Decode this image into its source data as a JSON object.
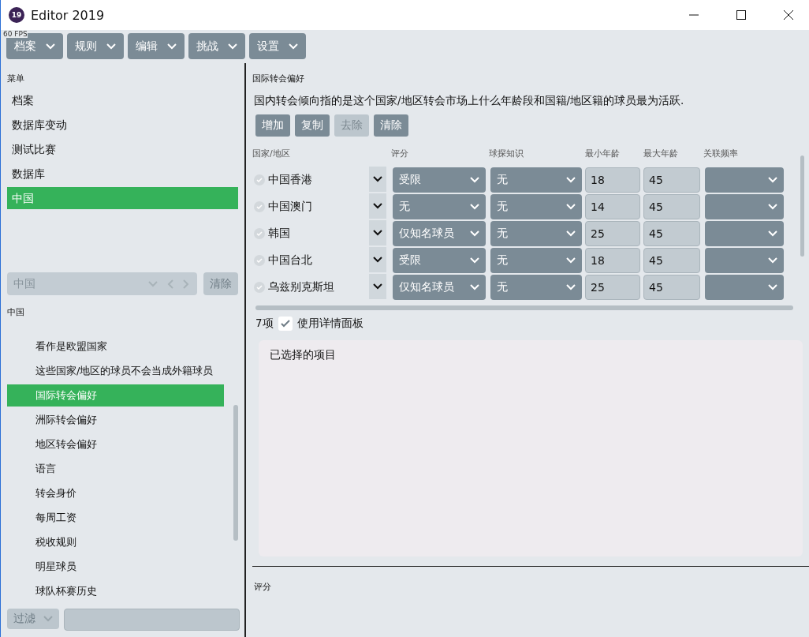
{
  "window": {
    "title": "Editor 2019",
    "icon_text": "19"
  },
  "fps_counter": "60 FPS",
  "toolbar": [
    {
      "label": "档案"
    },
    {
      "label": "规则"
    },
    {
      "label": "编辑"
    },
    {
      "label": "挑战"
    },
    {
      "label": "设置"
    }
  ],
  "menu": {
    "title": "菜单",
    "items": [
      {
        "label": "档案",
        "selected": false
      },
      {
        "label": "数据库变动",
        "selected": false
      },
      {
        "label": "测试比赛",
        "selected": false
      },
      {
        "label": "数据库",
        "selected": false
      },
      {
        "label": "中国",
        "selected": true
      }
    ]
  },
  "country_select": {
    "value": "中国",
    "clear_button": "清除",
    "disabled": true
  },
  "submenu": {
    "title": "中国",
    "items": [
      {
        "label": "看作是欧盟国家",
        "selected": false
      },
      {
        "label": "这些国家/地区的球员不会当成外籍球员",
        "selected": false
      },
      {
        "label": "国际转会偏好",
        "selected": true
      },
      {
        "label": "洲际转会偏好",
        "selected": false
      },
      {
        "label": "地区转会偏好",
        "selected": false
      },
      {
        "label": "语言",
        "selected": false
      },
      {
        "label": "转会身价",
        "selected": false
      },
      {
        "label": "每周工资",
        "selected": false
      },
      {
        "label": "税收规则",
        "selected": false
      },
      {
        "label": "明星球员",
        "selected": false
      },
      {
        "label": "球队杯赛历史",
        "selected": false
      }
    ]
  },
  "filter": {
    "label": "过滤"
  },
  "main": {
    "title": "国际转会偏好",
    "description": "国内转会倾向指的是这个国家/地区转会市场上什么年龄段和国籍/地区籍的球员最为活跃.",
    "buttons": [
      {
        "label": "增加",
        "disabled": false
      },
      {
        "label": "复制",
        "disabled": false
      },
      {
        "label": "去除",
        "disabled": true
      },
      {
        "label": "清除",
        "disabled": false
      }
    ],
    "columns": [
      "国家/地区",
      "评分",
      "球探知识",
      "最小年龄",
      "最大年龄",
      "关联频率"
    ],
    "rows": [
      {
        "country": "中国香港",
        "rating": "受限",
        "scout_knowledge": "无",
        "min_age": "18",
        "max_age": "45"
      },
      {
        "country": "中国澳门",
        "rating": "无",
        "scout_knowledge": "无",
        "min_age": "14",
        "max_age": "45"
      },
      {
        "country": "韩国",
        "rating": "仅知名球员",
        "scout_knowledge": "无",
        "min_age": "25",
        "max_age": "45"
      },
      {
        "country": "中国台北",
        "rating": "受限",
        "scout_knowledge": "无",
        "min_age": "18",
        "max_age": "45"
      },
      {
        "country": "乌兹别克斯坦",
        "rating": "仅知名球员",
        "scout_knowledge": "无",
        "min_age": "25",
        "max_age": "45"
      }
    ],
    "count": "7项",
    "detail_panel": {
      "label": "使用详情面板",
      "checked": true
    },
    "selected_panel": {
      "title": "已选择的项目"
    },
    "footer_title": "评分"
  }
}
